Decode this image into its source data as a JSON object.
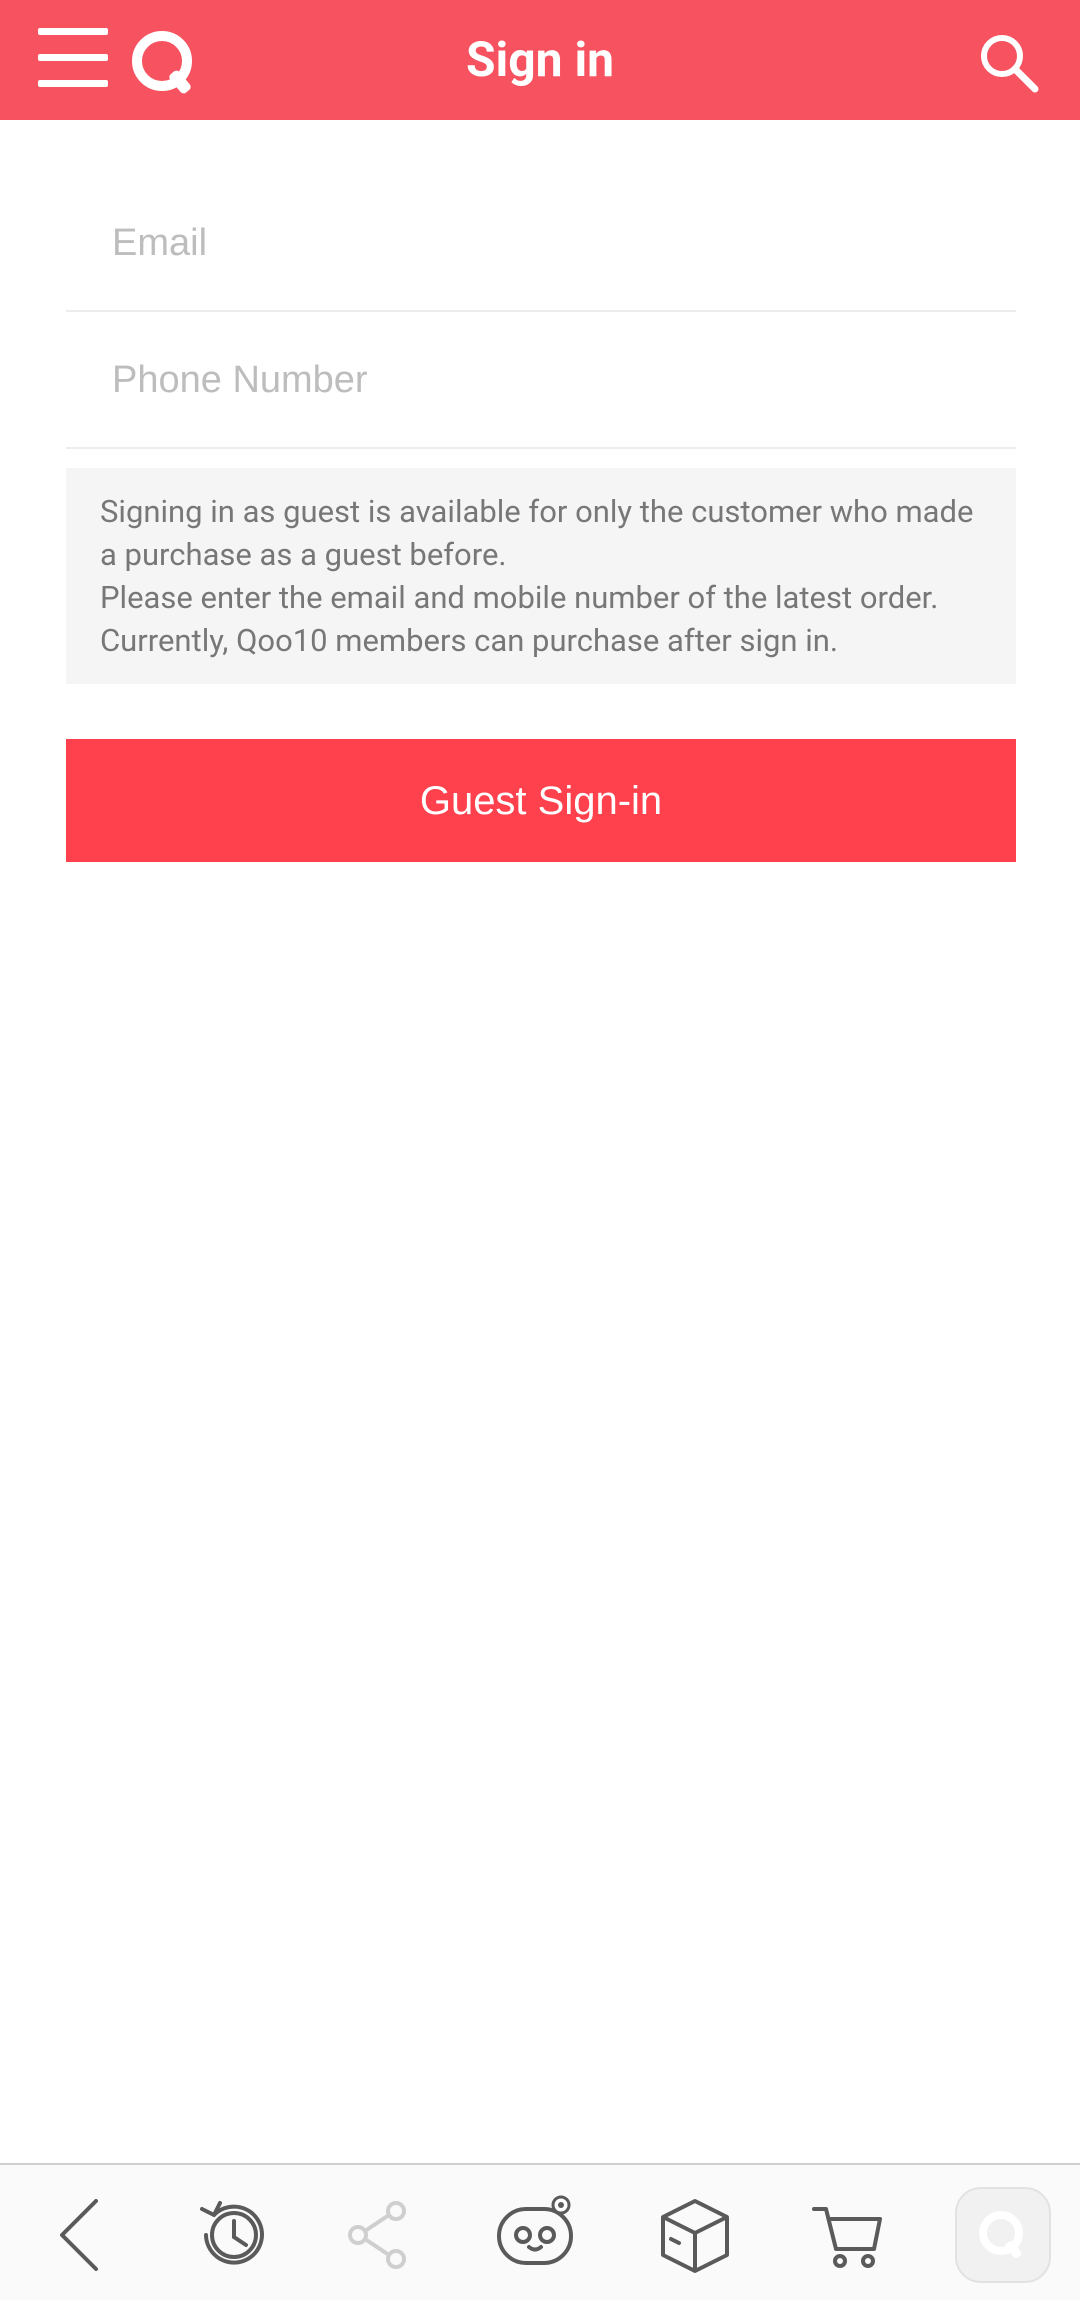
{
  "header": {
    "title": "Sign in",
    "bg_color": "#F7525F",
    "icons": [
      "menu-icon",
      "qoo10-logo-icon",
      "search-icon"
    ]
  },
  "form": {
    "email": {
      "value": "",
      "placeholder": "Email"
    },
    "phone": {
      "value": "",
      "placeholder": "Phone Number"
    }
  },
  "notice": {
    "line1": "Signing in as guest is available for only the customer who made a purchase as a guest before.",
    "line2": "Please enter the email and mobile number of the latest order. Currently, Qoo10 members can purchase after sign in."
  },
  "buttons": {
    "guest_signin": "Guest Sign-in",
    "guest_signin_color": "#FF404D"
  },
  "bottom_bar": {
    "icons": [
      "back-icon",
      "history-icon",
      "share-icon",
      "character-icon",
      "box-icon",
      "cart-icon",
      "qoo10-home-icon"
    ]
  }
}
